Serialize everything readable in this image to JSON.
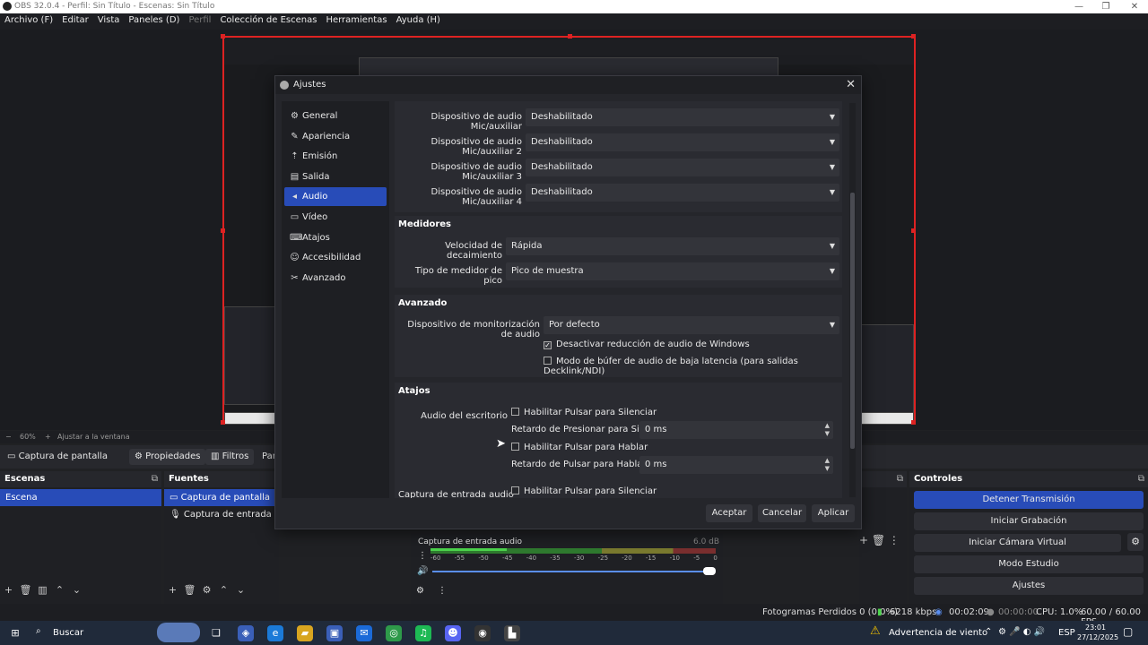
{
  "window": {
    "title": "OBS 32.0.4 - Perfil: Sin Título - Escenas: Sin Título",
    "minimize": "—",
    "maximize": "❐",
    "close": "✕"
  },
  "menu": [
    {
      "label": "Archivo (F)"
    },
    {
      "label": "Editar"
    },
    {
      "label": "Vista"
    },
    {
      "label": "Paneles (D)"
    },
    {
      "label": "Perfil",
      "disabled": true
    },
    {
      "label": "Colección de Escenas"
    },
    {
      "label": "Herramientas"
    },
    {
      "label": "Ayuda (H)"
    }
  ],
  "preview": {
    "zoom": "60%",
    "fit": "Ajustar a la ventana"
  },
  "source_toolbar": {
    "source_name": "Captura de pantalla",
    "properties": "Propiedades",
    "filters": "Filtros",
    "overflow": "Pan"
  },
  "scenes": {
    "title": "Escenas",
    "items": [
      "Escena"
    ]
  },
  "sources": {
    "title": "Fuentes",
    "items": [
      "Captura de pantalla",
      "Captura de entrada audio"
    ]
  },
  "mixer": {
    "channel": "Captura de entrada audio",
    "db": "6.0 dB",
    "scale": [
      "-60",
      "-55",
      "-50",
      "-45",
      "-40",
      "-35",
      "-30",
      "-25",
      "-20",
      "-15",
      "-10",
      "-5",
      "0"
    ]
  },
  "controls": {
    "title": "Controles",
    "buttons": [
      "Detener Transmisión",
      "Iniciar Grabación",
      "Iniciar Cámara Virtual",
      "Modo Estudio",
      "Ajustes"
    ]
  },
  "status": {
    "dropped": "Fotogramas Perdidos 0 (0.0%)",
    "bitrate": "6218 kbps",
    "stream_time": "00:02:09",
    "rec_time": "00:00:00",
    "cpu": "CPU: 1.0%",
    "fps": "60.00 / 60.00 FPS"
  },
  "taskbar": {
    "search": "Buscar",
    "weather": "Advertencia de viento",
    "lang": "ESP",
    "time": "23:01",
    "date": "27/12/2025"
  },
  "dialog": {
    "title": "Ajustes",
    "nav": [
      {
        "label": "General",
        "icon": "⚙"
      },
      {
        "label": "Apariencia",
        "icon": "✎"
      },
      {
        "label": "Emisión",
        "icon": "⇡"
      },
      {
        "label": "Salida",
        "icon": "▤"
      },
      {
        "label": "Audio",
        "icon": "◂",
        "active": true
      },
      {
        "label": "Vídeo",
        "icon": "▭"
      },
      {
        "label": "Atajos",
        "icon": "⌨"
      },
      {
        "label": "Accesibilidad",
        "icon": "☺"
      },
      {
        "label": "Avanzado",
        "icon": "✂"
      }
    ],
    "devices": [
      {
        "label": "Dispositivo de audio Mic/auxiliar",
        "value": "Deshabilitado"
      },
      {
        "label": "Dispositivo de audio Mic/auxiliar 2",
        "value": "Deshabilitado"
      },
      {
        "label": "Dispositivo de audio Mic/auxiliar 3",
        "value": "Deshabilitado"
      },
      {
        "label": "Dispositivo de audio Mic/auxiliar 4",
        "value": "Deshabilitado"
      }
    ],
    "meters": {
      "title": "Medidores",
      "decay_label": "Velocidad de decaimiento",
      "decay_value": "Rápida",
      "peak_label": "Tipo de medidor de pico",
      "peak_value": "Pico de muestra"
    },
    "advanced": {
      "title": "Avanzado",
      "monitor_label": "Dispositivo de monitorización de audio",
      "monitor_value": "Por defecto",
      "ducking": "Desactivar reducción de audio de Windows",
      "ducking_checked": true,
      "lowlatency": "Modo de búfer de audio de baja latencia (para salidas Decklink/NDI)",
      "lowlatency_checked": false
    },
    "hotkeys": {
      "title": "Atajos",
      "desktop_label": "Audio del escritorio",
      "ptm": "Habilitar Pulsar para Silenciar",
      "ptm_delay_label": "Retardo de Presionar para Silenciar",
      "ptm_delay": "0 ms",
      "ptt": "Habilitar Pulsar para Hablar",
      "ptt_delay_label": "Retardo de Pulsar para Hablar",
      "ptt_delay": "0 ms",
      "input_label": "Captura de entrada audio",
      "input_ptm": "Habilitar Pulsar para Silenciar"
    },
    "buttons": {
      "accept": "Aceptar",
      "cancel": "Cancelar",
      "apply": "Aplicar"
    }
  }
}
